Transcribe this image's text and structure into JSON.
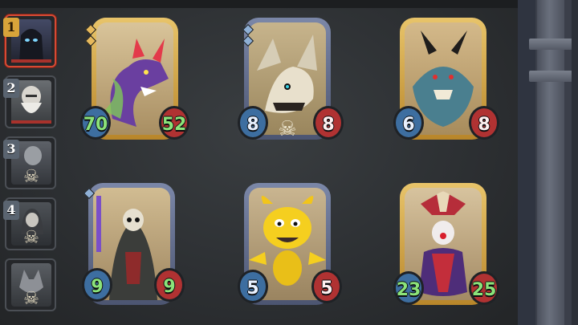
{
  "roster": [
    {
      "number": "1",
      "active": true,
      "badge_color": "#d8a43a",
      "portrait": "hooded-knight",
      "has_skull": false
    },
    {
      "number": "2",
      "active": false,
      "badge_color": "#5a6470",
      "portrait": "old-bearded-man",
      "has_skull": false
    },
    {
      "number": "3",
      "active": false,
      "badge_color": "#5a6470",
      "portrait": "grey-figure",
      "has_skull": true
    },
    {
      "number": "4",
      "active": false,
      "badge_color": "#5a6470",
      "portrait": "hooded-woman",
      "has_skull": true
    },
    {
      "number": "",
      "active": false,
      "badge_color": "#5a6470",
      "portrait": "wolf-creature",
      "has_skull": true
    }
  ],
  "cards": [
    {
      "name": "purple-dragon",
      "attack": "70",
      "health": "52",
      "attack_buffed": true,
      "health_buffed": true,
      "frame": "gold",
      "gems": [
        "gold",
        "gold"
      ],
      "skull_below": false
    },
    {
      "name": "bone-dragon",
      "attack": "8",
      "health": "8",
      "attack_buffed": false,
      "health_buffed": false,
      "frame": "silver",
      "gems": [
        "blue",
        "blue"
      ],
      "skull_below": true
    },
    {
      "name": "horned-yeti-beast",
      "attack": "6",
      "health": "8",
      "attack_buffed": false,
      "health_buffed": false,
      "frame": "gold",
      "gems": [],
      "skull_below": false
    },
    {
      "name": "skull-masked-reaper",
      "attack": "9",
      "health": "9",
      "attack_buffed": true,
      "health_buffed": true,
      "frame": "silver",
      "gems": [
        "blue"
      ],
      "skull_below": false
    },
    {
      "name": "yellow-imp",
      "attack": "5",
      "health": "5",
      "attack_buffed": false,
      "health_buffed": false,
      "frame": "silver",
      "gems": [],
      "skull_below": false
    },
    {
      "name": "jester-clown",
      "attack": "23",
      "health": "25",
      "attack_buffed": true,
      "health_buffed": true,
      "frame": "gold",
      "gems": [],
      "skull_below": false
    }
  ],
  "colors": {
    "attack_orb": "#3d6ea0",
    "health_orb": "#b03232",
    "buffed_text": "#8be37a",
    "active_slot_border": "#d64a34"
  }
}
